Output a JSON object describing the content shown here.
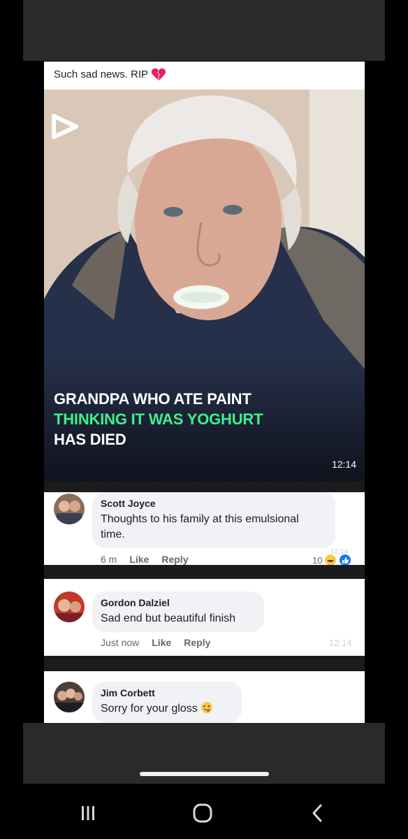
{
  "post": {
    "caption": "Such sad news. RIP",
    "video": {
      "headline_line1": "GRANDPA WHO ATE PAINT",
      "headline_line2": "THINKING IT WAS YOGHURT",
      "headline_line3": "HAS DIED",
      "timestamp": "12:14",
      "headline_accent_color": "#3ef08b"
    }
  },
  "comments": [
    {
      "name": "Scott Joyce",
      "text_line1": "Thoughts to his family at this emulsional",
      "text_line2": "time.",
      "time": "6 m",
      "like_label": "Like",
      "reply_label": "Reply",
      "reaction_count": "10",
      "faded_timestamp": "12:14"
    },
    {
      "name": "Gordon Dalziel",
      "text": "Sad end but beautiful finish",
      "time": "Just now",
      "like_label": "Like",
      "reply_label": "Reply",
      "faded_timestamp": "12:14"
    },
    {
      "name": "Jim Corbett",
      "text": "Sorry for your gloss"
    }
  ],
  "system_nav": {
    "icons": [
      "recent-apps-icon",
      "home-icon",
      "back-icon"
    ]
  }
}
